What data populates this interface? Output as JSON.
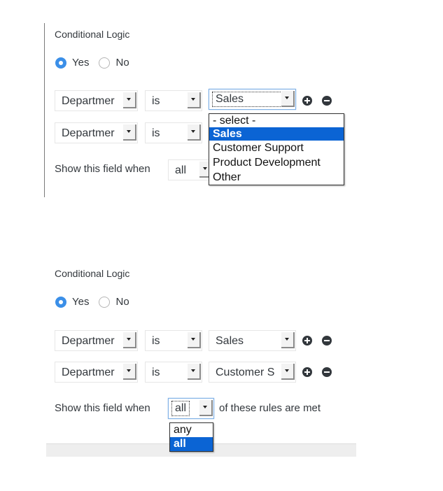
{
  "panel_top": {
    "heading": "Conditional Logic",
    "radios": [
      {
        "label": "Yes",
        "checked": true
      },
      {
        "label": "No",
        "checked": false
      }
    ],
    "rules": [
      {
        "field": "Departmer",
        "operator": "is",
        "value": "Sales",
        "add_icon": "plus-circle-icon",
        "remove_icon": "minus-circle-icon"
      },
      {
        "field": "Departmer",
        "operator": "is",
        "value": ""
      }
    ],
    "show_when_label": "Show this field when",
    "show_when_value": "all",
    "open_dropdown": {
      "options": [
        "- select -",
        "Sales",
        "Customer Support",
        "Product Development",
        "Other"
      ],
      "selected": "Sales"
    }
  },
  "panel_bottom": {
    "heading": "Conditional Logic",
    "radios": [
      {
        "label": "Yes",
        "checked": true
      },
      {
        "label": "No",
        "checked": false
      }
    ],
    "rules": [
      {
        "field": "Departmer",
        "operator": "is",
        "value": "Sales",
        "add_icon": "plus-circle-icon",
        "remove_icon": "minus-circle-icon"
      },
      {
        "field": "Departmer",
        "operator": "is",
        "value": "Customer S",
        "add_icon": "plus-circle-icon",
        "remove_icon": "minus-circle-icon"
      }
    ],
    "show_when_label": "Show this field when",
    "show_when_value": "all",
    "show_when_suffix": "of these rules are met",
    "open_dropdown": {
      "options": [
        "any",
        "all"
      ],
      "selected": "all"
    }
  },
  "colors": {
    "accent": "#3b8fe8",
    "selection": "#0b64d4",
    "text": "#32373c"
  }
}
